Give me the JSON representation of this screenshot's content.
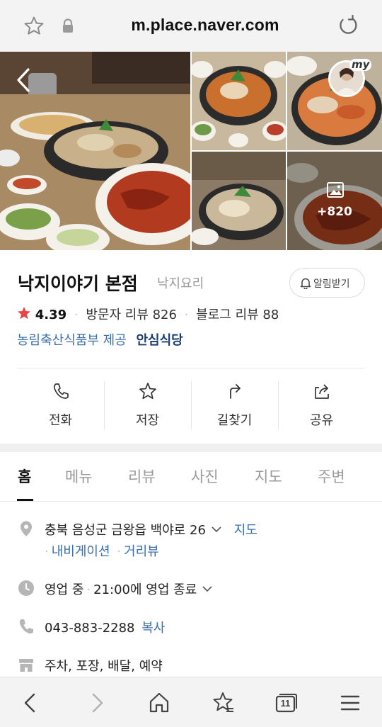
{
  "browser": {
    "url": "m.place.naver.com",
    "icons": [
      "bookmark-star-icon",
      "lock-icon",
      "reload-icon"
    ]
  },
  "photos": {
    "more_count": "+820",
    "badge_text": "my"
  },
  "place": {
    "name": "낙지이야기 본점",
    "category": "낙지요리",
    "alarm_label": "알림받기",
    "rating": "4.39",
    "visitor_reviews": "방문자 리뷰 826",
    "blog_reviews": "블로그 리뷰 88",
    "cert_agency": "농림축산식품부 제공",
    "cert_badge": "안심식당"
  },
  "actions": [
    {
      "label": "전화",
      "icon": "phone-icon"
    },
    {
      "label": "저장",
      "icon": "star-icon"
    },
    {
      "label": "길찾기",
      "icon": "directions-icon"
    },
    {
      "label": "공유",
      "icon": "share-icon"
    }
  ],
  "tabs": [
    {
      "label": "홈",
      "active": true
    },
    {
      "label": "메뉴"
    },
    {
      "label": "리뷰"
    },
    {
      "label": "사진"
    },
    {
      "label": "지도"
    },
    {
      "label": "주변"
    }
  ],
  "info": {
    "address": "충북 음성군 금왕읍 백야로 26",
    "map_link": "지도",
    "navigation_link": "내비게이션",
    "distance_link": "거리뷰",
    "hours_status": "영업 중",
    "hours_detail": "21:00에 영업 종료",
    "phone": "043-883-2288",
    "copy_link": "복사",
    "services": "주차, 포장, 배달, 예약"
  },
  "bottom_nav": {
    "tab_count": "11",
    "icons": [
      "back-icon",
      "forward-icon",
      "home-icon",
      "bookmarks-icon",
      "tabs-icon",
      "menu-icon"
    ]
  },
  "colors": {
    "accent_blue": "#3b6fae",
    "rating_star": "#e84545",
    "badge_navy": "#1b3d6e"
  }
}
